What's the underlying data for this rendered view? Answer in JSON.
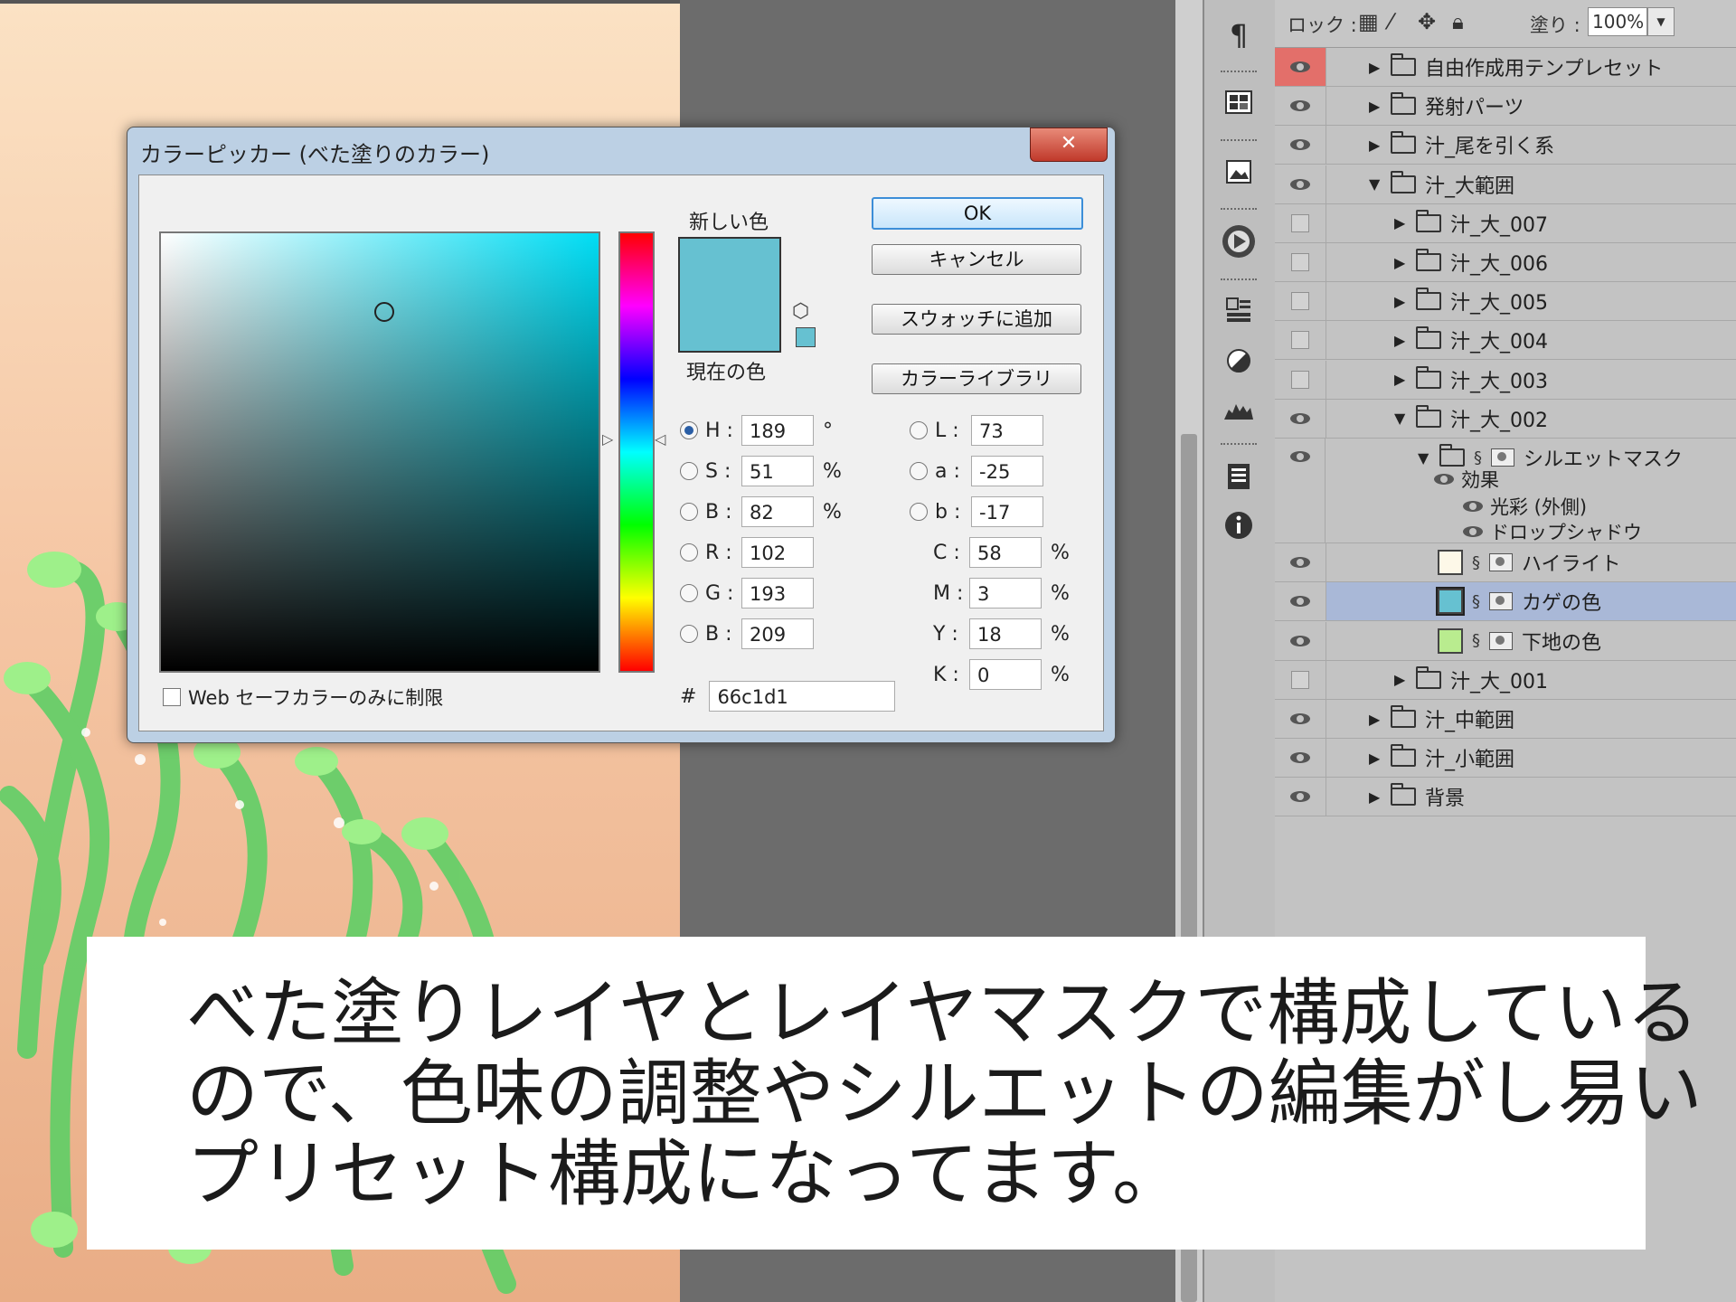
{
  "dialog": {
    "title": "カラーピッカー (べた塗りのカラー)",
    "close_label": "✕",
    "new_color_label": "新しい色",
    "current_color_label": "現在の色",
    "new_color_hex": "#66c1d1",
    "buttons": {
      "ok": "OK",
      "cancel": "キャンセル",
      "add_swatch": "スウォッチに追加",
      "color_libraries": "カラーライブラリ"
    },
    "hsb": [
      {
        "label": "H :",
        "value": "189",
        "unit": "°"
      },
      {
        "label": "S :",
        "value": "51",
        "unit": "%"
      },
      {
        "label": "B :",
        "value": "82",
        "unit": "%"
      }
    ],
    "rgb": [
      {
        "label": "R :",
        "value": "102"
      },
      {
        "label": "G :",
        "value": "193"
      },
      {
        "label": "B :",
        "value": "209"
      }
    ],
    "lab": [
      {
        "label": "L :",
        "value": "73"
      },
      {
        "label": "a :",
        "value": "-25"
      },
      {
        "label": "b :",
        "value": "-17"
      }
    ],
    "cmyk": [
      {
        "label": "C :",
        "value": "58",
        "unit": "%"
      },
      {
        "label": "M :",
        "value": "3",
        "unit": "%"
      },
      {
        "label": "Y :",
        "value": "18",
        "unit": "%"
      },
      {
        "label": "K :",
        "value": "0",
        "unit": "%"
      }
    ],
    "hex_label": "#",
    "hex_value": "66c1d1",
    "websafe_label": "Web セーフカラーのみに制限",
    "hue_color": "#00ddf4"
  },
  "layers_panel": {
    "lock_label": "ロック :",
    "fill_label": "塗り :",
    "fill_value": "100%",
    "layers": [
      {
        "name": "自由作成用テンプレセット",
        "type": "folder",
        "visible": true
      },
      {
        "name": "発射パーツ",
        "type": "folder",
        "visible": true
      },
      {
        "name": "汁_尾を引く系",
        "type": "folder",
        "visible": true
      },
      {
        "name": "汁_大範囲",
        "type": "folder-open",
        "visible": true
      },
      {
        "name": "汁_大_007",
        "type": "folder",
        "visible": false
      },
      {
        "name": "汁_大_006",
        "type": "folder",
        "visible": false
      },
      {
        "name": "汁_大_005",
        "type": "folder",
        "visible": false
      },
      {
        "name": "汁_大_004",
        "type": "folder",
        "visible": false
      },
      {
        "name": "汁_大_003",
        "type": "folder",
        "visible": false
      },
      {
        "name": "汁_大_002",
        "type": "folder-open",
        "visible": true
      },
      {
        "name": "シルエットマスク",
        "type": "folder-mask",
        "visible": true
      },
      {
        "name": "ハイライト",
        "type": "fill",
        "visible": true,
        "color": "#fdf8e8"
      },
      {
        "name": "カゲの色",
        "type": "fill",
        "visible": true,
        "color": "#66c1d1",
        "selected": true
      },
      {
        "name": "下地の色",
        "type": "fill",
        "visible": true,
        "color": "#b9ec8f"
      },
      {
        "name": "汁_大_001",
        "type": "folder",
        "visible": false
      },
      {
        "name": "汁_中範囲",
        "type": "folder",
        "visible": true
      },
      {
        "name": "汁_小範囲",
        "type": "folder",
        "visible": true
      },
      {
        "name": "背景",
        "type": "folder",
        "visible": true
      }
    ],
    "effects": {
      "title": "効果",
      "items": [
        "光彩 (外側)",
        "ドロップシャドウ"
      ]
    }
  },
  "caption": {
    "lines": [
      "べた塗りレイヤとレイヤマスクで構成している",
      "ので、色味の調整やシルエットの編集がし易い",
      "プリセット構成になってます。"
    ]
  }
}
